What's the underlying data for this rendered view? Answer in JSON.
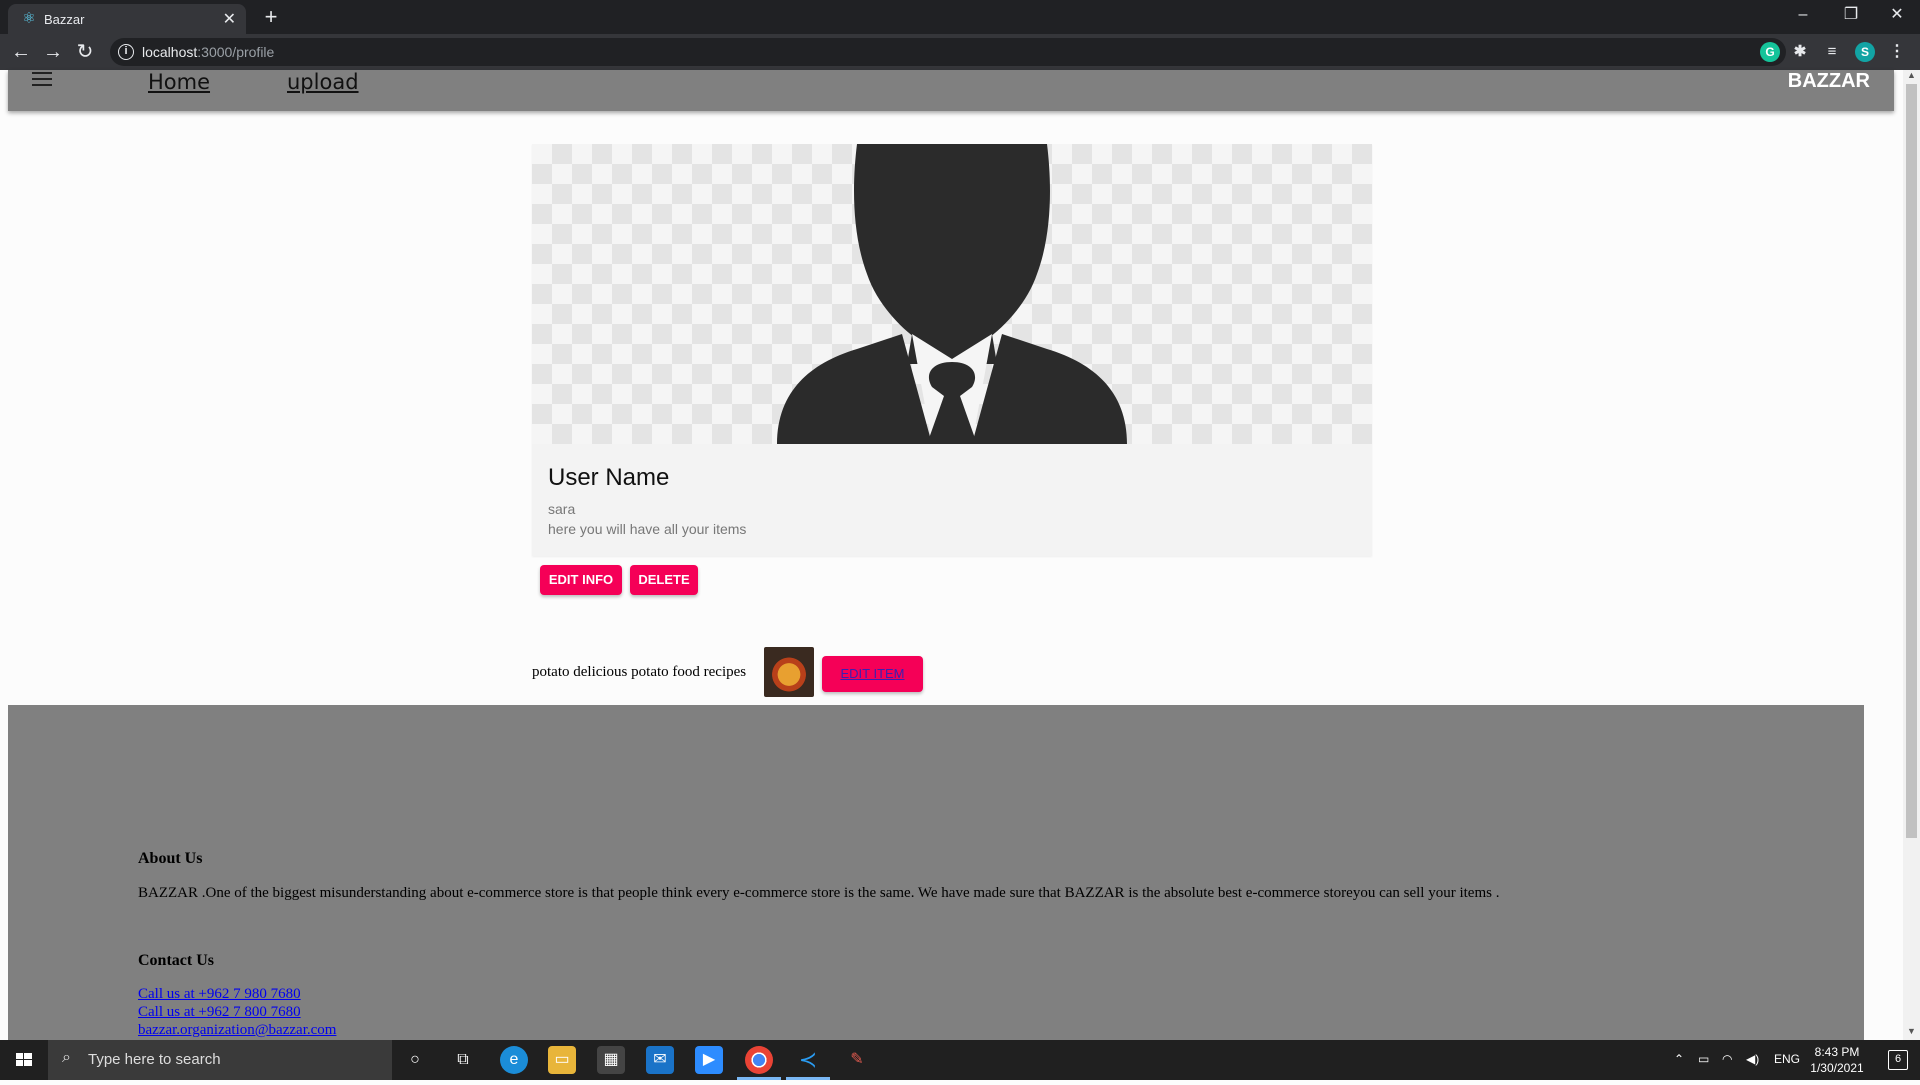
{
  "browser": {
    "tab_title": "Bazzar",
    "url_host": "localhost",
    "url_path": ":3000/profile",
    "profile_initial": "S"
  },
  "header": {
    "links": [
      "Home ",
      "upload"
    ],
    "brand": "BAZZAR"
  },
  "profile": {
    "title": "User Name",
    "username": "sara",
    "description": "here you will have all your items",
    "edit_label": "EDIT INFO",
    "delete_label": "DELETE"
  },
  "items": [
    {
      "text": "potato delicious potato food recipes",
      "edit_label": "EDIT ITEM"
    }
  ],
  "footer": {
    "about_heading": "About Us",
    "about_text": "BAZZAR .One of the biggest misunderstanding about e-commerce store is that people think every e-commerce store is the same. We have made sure that BAZZAR is the absolute best e-commerce storeyou can sell your items .",
    "contact_heading": "Contact Us",
    "contacts": [
      "Call us at +962 7 980 7680",
      "Call us at +962 7 800 7680",
      "bazzar.organization@bazzar.com"
    ]
  },
  "taskbar": {
    "search_placeholder": "Type here to search",
    "language": "ENG",
    "time": "8:43 PM",
    "date": "1/30/2021",
    "notification_count": "6"
  },
  "colors": {
    "accent": "#f50057",
    "header_bg": "#808080",
    "footer_bg": "#808080"
  }
}
